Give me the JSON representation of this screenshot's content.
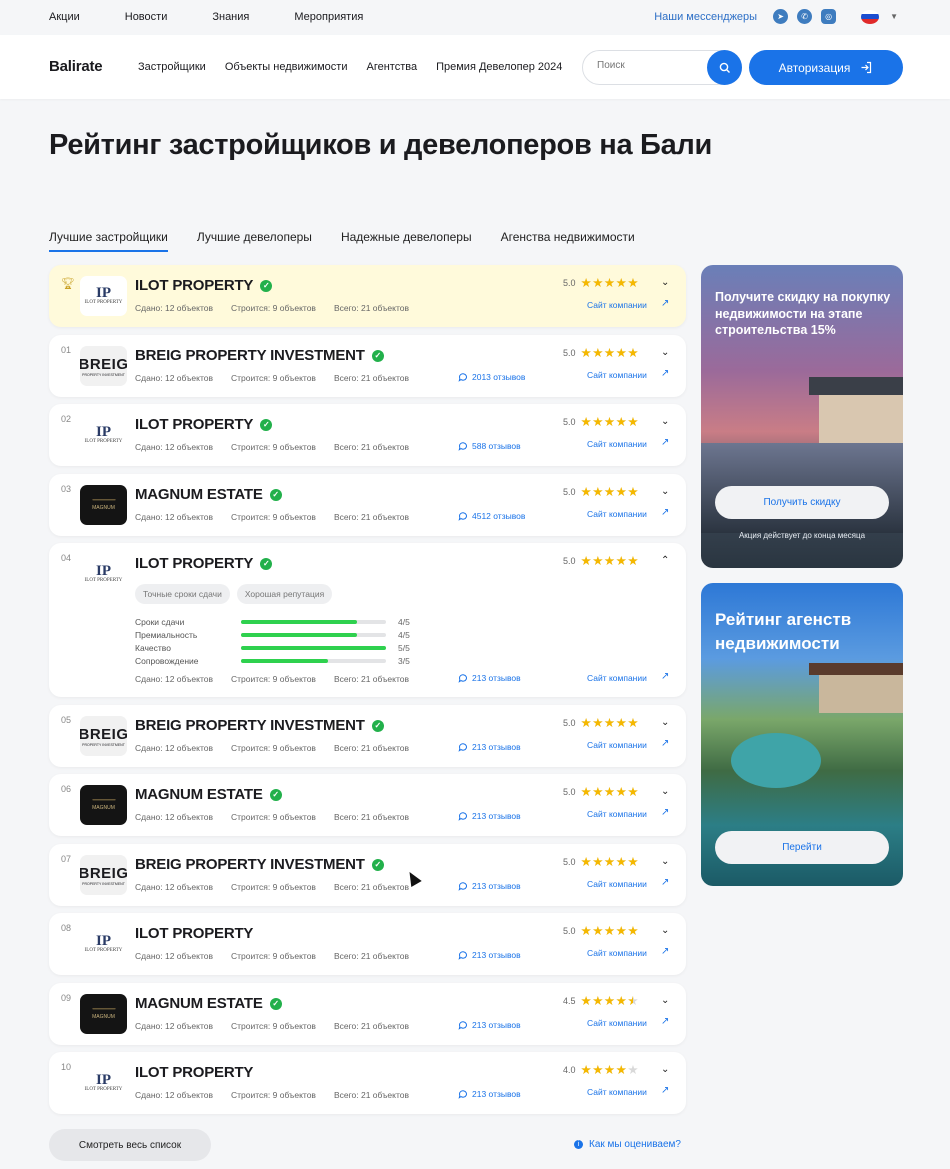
{
  "topbar": {
    "links": [
      "Акции",
      "Новости",
      "Знания",
      "Мероприятия"
    ],
    "messengers_label": "Наши мессенджеры",
    "icons": [
      "telegram-icon",
      "whatsapp-icon",
      "instagram-icon"
    ],
    "language_flag": "ru"
  },
  "header": {
    "logo": "Balirate",
    "nav": [
      "Застройщики",
      "Объекты недвижимости",
      "Агентства",
      "Премия Девелопер 2024"
    ],
    "search_placeholder": "Поиск",
    "auth_label": "Авторизация"
  },
  "page": {
    "title": "Рейтинг застройщиков и девелоперов на Бали",
    "tabs": [
      "Лучшие застройщики",
      "Лучшие девелоперы",
      "Надежные девелоперы",
      "Агенства недвижимости"
    ],
    "active_tab": 0
  },
  "labels": {
    "site": "Сайт компании",
    "done": "Сдано:",
    "building": "Строится:",
    "total": "Всего:"
  },
  "companies": [
    {
      "rank": "",
      "name": "ILOT PROPERTY",
      "logo": "ilot",
      "verified": true,
      "rating": "5.0",
      "rating_value": 5.0,
      "done": "12 объектов",
      "building": "9 объектов",
      "total": "21 объектов",
      "reviews": "",
      "highlight": true
    },
    {
      "rank": "01",
      "name": "BREIG PROPERTY INVESTMENT",
      "logo": "breig",
      "verified": true,
      "rating": "5.0",
      "rating_value": 5.0,
      "done": "12 объектов",
      "building": "9 объектов",
      "total": "21 объектов",
      "reviews": "2013 отзывов"
    },
    {
      "rank": "02",
      "name": "ILOT PROPERTY",
      "logo": "ilot",
      "verified": true,
      "rating": "5.0",
      "rating_value": 5.0,
      "done": "12 объектов",
      "building": "9 объектов",
      "total": "21 объектов",
      "reviews": "588 отзывов"
    },
    {
      "rank": "03",
      "name": "MAGNUM ESTATE",
      "logo": "magnum",
      "verified": true,
      "rating": "5.0",
      "rating_value": 5.0,
      "done": "12 объектов",
      "building": "9 объектов",
      "total": "21 объектов",
      "reviews": "4512 отзывов"
    },
    {
      "rank": "04",
      "name": "ILOT PROPERTY",
      "logo": "ilot",
      "verified": true,
      "rating": "5.0",
      "rating_value": 5.0,
      "done": "12 объектов",
      "building": "9 объектов",
      "total": "21 объектов",
      "reviews": "213 отзывов",
      "expanded": true,
      "tags": [
        "Точные сроки сдачи",
        "Хорошая репутация"
      ],
      "criteria": [
        {
          "label": "Сроки сдачи",
          "score": "4/5",
          "fraction": 0.8
        },
        {
          "label": "Премиальность",
          "score": "4/5",
          "fraction": 0.8
        },
        {
          "label": "Качество",
          "score": "5/5",
          "fraction": 1.0
        },
        {
          "label": "Сопровождение",
          "score": "3/5",
          "fraction": 0.6
        }
      ]
    },
    {
      "rank": "05",
      "name": "BREIG PROPERTY INVESTMENT",
      "logo": "breig",
      "verified": true,
      "rating": "5.0",
      "rating_value": 5.0,
      "done": "12 объектов",
      "building": "9 объектов",
      "total": "21 объектов",
      "reviews": "213 отзывов"
    },
    {
      "rank": "06",
      "name": "MAGNUM ESTATE",
      "logo": "magnum",
      "verified": true,
      "rating": "5.0",
      "rating_value": 5.0,
      "done": "12 объектов",
      "building": "9 объектов",
      "total": "21 объектов",
      "reviews": "213 отзывов"
    },
    {
      "rank": "07",
      "name": "BREIG PROPERTY INVESTMENT",
      "logo": "breig",
      "verified": true,
      "rating": "5.0",
      "rating_value": 5.0,
      "done": "12 объектов",
      "building": "9 объектов",
      "total": "21 объектов",
      "reviews": "213 отзывов"
    },
    {
      "rank": "08",
      "name": "ILOT PROPERTY",
      "logo": "ilot",
      "verified": false,
      "rating": "5.0",
      "rating_value": 5.0,
      "done": "12 объектов",
      "building": "9 объектов",
      "total": "21 объектов",
      "reviews": "213 отзывов"
    },
    {
      "rank": "09",
      "name": "MAGNUM ESTATE",
      "logo": "magnum",
      "verified": true,
      "rating": "4.5",
      "rating_value": 4.5,
      "done": "12 объектов",
      "building": "9 объектов",
      "total": "21 объектов",
      "reviews": "213 отзывов"
    },
    {
      "rank": "10",
      "name": "ILOT PROPERTY",
      "logo": "ilot",
      "verified": false,
      "rating": "4.0",
      "rating_value": 4.0,
      "done": "12 объектов",
      "building": "9 объектов",
      "total": "21 объектов",
      "reviews": "213 отзывов"
    }
  ],
  "logos": {
    "ilot": {
      "mark": "IP",
      "caption": "ILOT PROPERTY"
    },
    "breig": {
      "mark": "BREIG",
      "caption": "PROPERTY INVESTMENT"
    },
    "magnum": {
      "mark": "",
      "caption": "MAGNUM"
    }
  },
  "promos": [
    {
      "title": "Получите скидку на покупку недвижимости на этапе строительства 15%",
      "button": "Получить скидку",
      "note": "Акция действует до конца месяца"
    },
    {
      "title": "Рейтинг агенств недвижимости",
      "button": "Перейти"
    }
  ],
  "footer": {
    "view_all": "Смотреть весь список",
    "how_we_rate": "Как мы оцениваем?"
  },
  "colors": {
    "accent": "#1a73e8",
    "star": "#f5b800",
    "verified": "#22b04b",
    "bar": "#2ed14e",
    "highlight": "#fffadb"
  }
}
